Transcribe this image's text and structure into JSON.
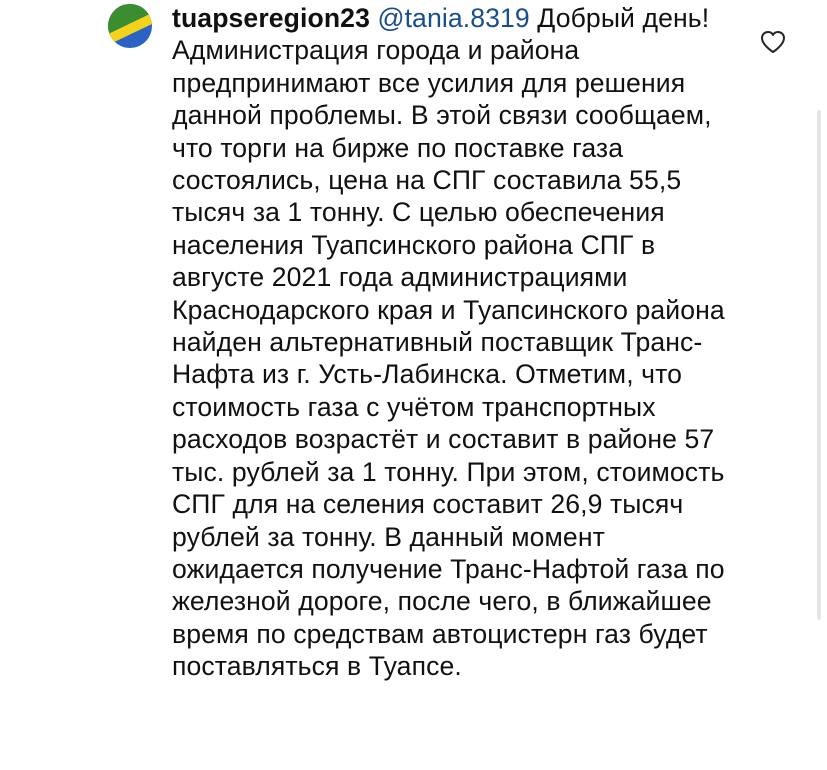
{
  "comment": {
    "username": "tuapseregion23",
    "mention": "@tania.8319",
    "text": "Добрый день! Администрация города и района предпринимают все усилия для решения данной проблемы. В этой связи сообщаем, что торги на бирже по поставке газа состоялись, цена на СПГ составила 55,5 тысяч за 1 тонну. С целью обеспечения населения Туапсинского района СПГ в августе 2021 года администрациями Краснодарского края и Туапсинского района найден альтернативный поставщик Транс-Нафта из г. Усть-Лабинска. Отметим, что стоимость газа с учётом транспортных расходов возрастёт и составит в районе 57 тыс. рублей за 1 тонну. При этом, стоимость СПГ для на селения составит 26,9 тысяч рублей за тонну. В данный момент ожидается получение Транс-Нафтой газа по железной дороге, после чего, в ближайшее время по средствам автоцистерн газ будет поставляться в Туапсе.",
    "avatar_colors": [
      "#3a8e2f",
      "#f2d21b",
      "#2a63c4"
    ],
    "like_icon": "heart-outline-icon"
  }
}
